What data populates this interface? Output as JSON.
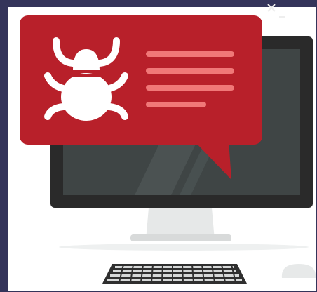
{
  "illustration": {
    "subject": "bug-alert-computer",
    "colors": {
      "frame": "#34345a",
      "background": "#ffffff",
      "alert_red": "#b8202a",
      "alert_lines": "#f07878",
      "bug": "#ffffff",
      "monitor_bezel": "#2a2a2a",
      "screen": "#3f4545",
      "stand": "#e4e6e6",
      "keyboard": "#2f2f2f",
      "mouse": "#e7e9e9"
    },
    "icons": [
      "bug-icon",
      "chat-bubble-icon",
      "monitor-icon",
      "keyboard-icon",
      "mouse-icon"
    ]
  }
}
